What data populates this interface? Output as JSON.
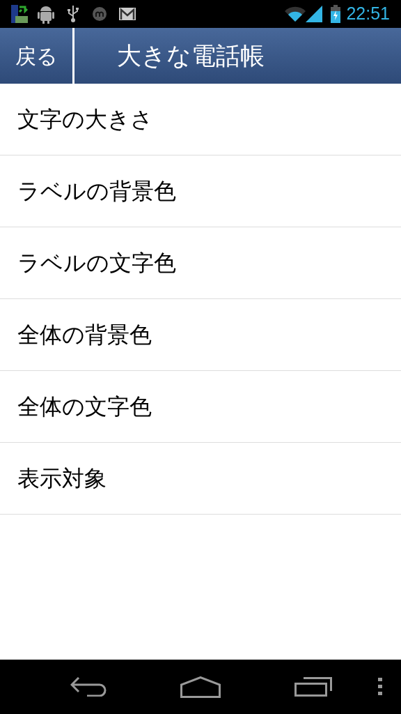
{
  "status_bar": {
    "time": "22:51"
  },
  "header": {
    "back_button": "戻る",
    "title": "大きな電話帳"
  },
  "menu": {
    "items": [
      {
        "label": "文字の大きさ"
      },
      {
        "label": "ラベルの背景色"
      },
      {
        "label": "ラベルの文字色"
      },
      {
        "label": "全体の背景色"
      },
      {
        "label": "全体の文字色"
      },
      {
        "label": "表示対象"
      }
    ]
  }
}
